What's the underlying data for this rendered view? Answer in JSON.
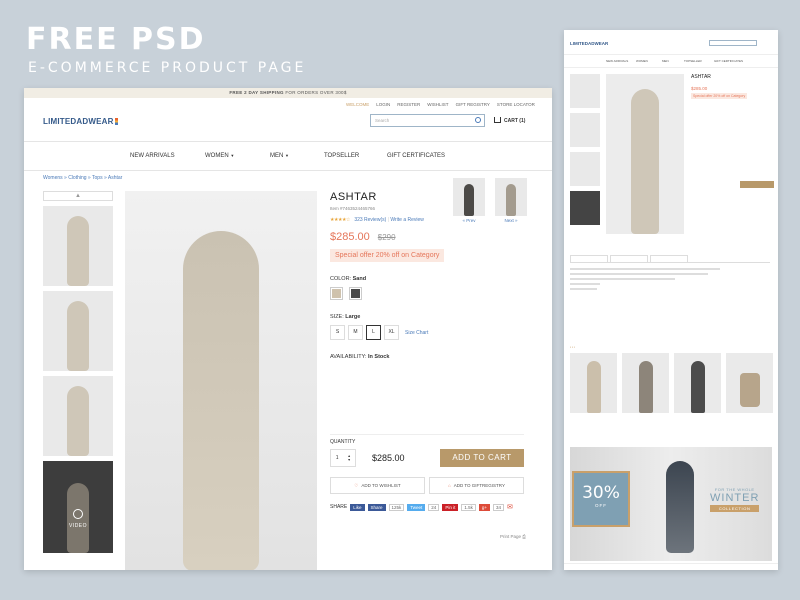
{
  "headline": "FREE PSD",
  "subline": "E-COMMERCE PRODUCT PAGE",
  "promo": {
    "bold": "FREE 2 DAY SHIPPING",
    "rest": " FOR ORDERS OVER 300$"
  },
  "toplinks": [
    "WELCOME",
    "LOGIN",
    "REGISTER",
    "WISHLIST",
    "GIFT REGISTRY",
    "STORE LOCATOR"
  ],
  "logo": "LIMITEDADWEAR",
  "search": {
    "placeholder": "Search"
  },
  "cart": "CART (1)",
  "nav": [
    "NEW ARRIVALS",
    "WOMEN",
    "MEN",
    "TOPSELLER",
    "GIFT CERTIFICATES"
  ],
  "breadcrumb": "Womens » Clothing » Tops » Ashtar",
  "thumb_video_label": "VIDEO",
  "product": {
    "title": "ASHTAR",
    "item": "Item #7463524465766",
    "stars": "★★★★☆",
    "reviews": "323 Review(s)",
    "write_review": "Write a Review",
    "price": "$285.00",
    "old_price": "$290",
    "offer": "Special offer 20% off on Category",
    "color_label": "COLOR:",
    "color_value": "Sand",
    "colors": [
      "#cfc2ad",
      "#4a4a4a"
    ],
    "size_label": "SIZE:",
    "size_value": "Large",
    "sizes": [
      "S",
      "M",
      "L",
      "XL"
    ],
    "selected_size": "L",
    "size_chart": "Size Chart",
    "availability_label": "AVAILABILITY:",
    "availability_value": "In Stock"
  },
  "alt_nav": {
    "prev": "« Prev",
    "next": "Next »"
  },
  "quantity": {
    "label": "QUANTITY",
    "value": "1",
    "total": "$285.00"
  },
  "add_to_cart": "ADD TO CART",
  "wishlist": "ADD TO WISHLIST",
  "giftregistry": "ADD TO GIFTREGISTRY",
  "share": {
    "label": "SHARE",
    "like": "Like",
    "share_btn": "Share",
    "fb_count": "125k",
    "tweet": "Tweet",
    "tw_count": "24",
    "pin": "Pin it",
    "pin_count": "1.5k",
    "gplus_count": "34"
  },
  "print_page": "Print Page",
  "colors": {
    "accent": "#b8996a",
    "link": "#4a7ab8",
    "sale": "#e5765a",
    "promo_bg": "#f1ede4"
  }
}
